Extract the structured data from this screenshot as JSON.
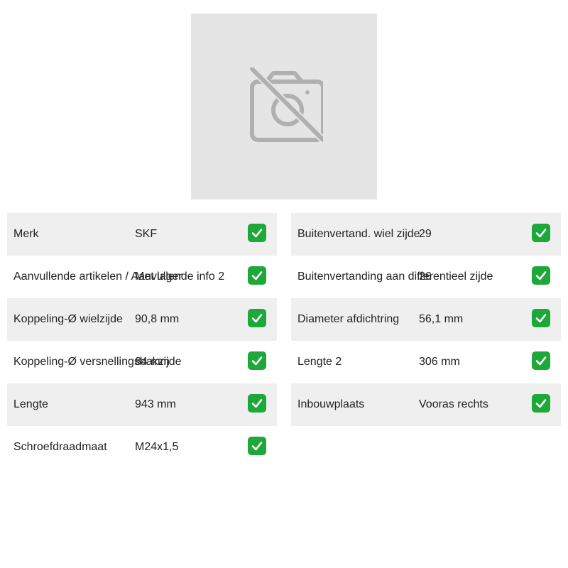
{
  "image": {
    "icon": "no-photo-camera-icon"
  },
  "colors": {
    "check_bg": "#1fa83a",
    "row_shade": "#efefef",
    "image_bg": "#e5e5e5",
    "icon": "#b0b0b0"
  },
  "left_specs": [
    {
      "label": "Merk",
      "value": "SKF"
    },
    {
      "label": "Aanvullende artikelen / Aanvullende info 2",
      "value": "Met lager"
    },
    {
      "label": "Koppeling-Ø wielzijde",
      "value": "90,8 mm"
    },
    {
      "label": "Koppeling-Ø versnellingsbakzijde",
      "value": "84 mm"
    },
    {
      "label": "Lengte",
      "value": "943 mm"
    },
    {
      "label": "Schroefdraadmaat",
      "value": "M24x1,5"
    }
  ],
  "right_specs": [
    {
      "label": "Buitenvertand. wiel zijde",
      "value": "29"
    },
    {
      "label": "Buitenvertanding aan differentieel zijde",
      "value": "26"
    },
    {
      "label": "Diameter afdichtring",
      "value": "56,1 mm"
    },
    {
      "label": "Lengte 2",
      "value": "306 mm"
    },
    {
      "label": "Inbouwplaats",
      "value": "Vooras rechts"
    }
  ]
}
